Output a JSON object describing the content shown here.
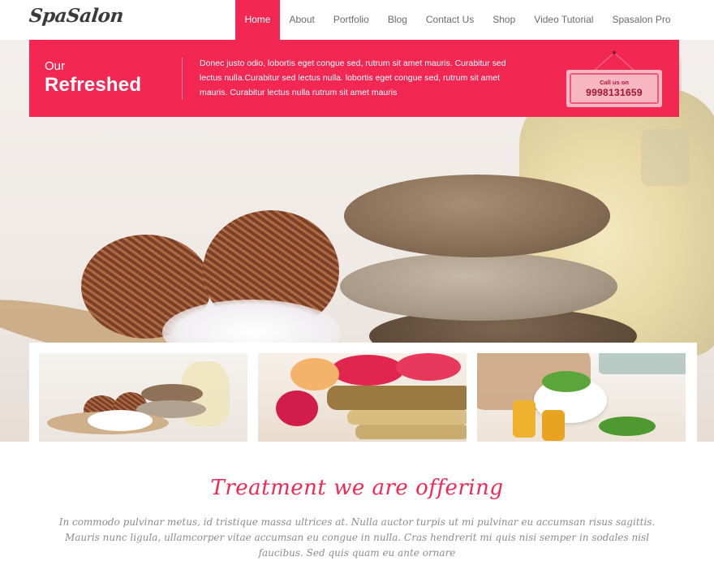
{
  "header": {
    "logo": "SpaSalon",
    "nav": [
      {
        "label": "Home",
        "active": true
      },
      {
        "label": "About"
      },
      {
        "label": "Portfolio"
      },
      {
        "label": "Blog"
      },
      {
        "label": "Contact Us"
      },
      {
        "label": "Shop"
      },
      {
        "label": "Video Tutorial"
      },
      {
        "label": "Spasalon Pro"
      }
    ]
  },
  "banner": {
    "small_title": "Our",
    "big_title": "Refreshed",
    "text": "Donec justo odio, lobortis eget congue sed, rutrum sit amet mauris. Curabitur sed lectus nulla.Curabitur sed lectus nulla. lobortis eget congue sed, rutrum sit amet mauris. Curabitur lectus nulla rutrum sit amet mauris",
    "call_label": "Call us on",
    "call_number": "9998131659"
  },
  "section": {
    "title": "Treatment we are offering",
    "text": "In commodo pulvinar metus, id tristique massa ultrices at. Nulla auctor turpis ut mi pulvinar eu accumsan risus sagittis. Mauris nunc ligula, ullamcorper vitae accumsan eu congue in nulla. Cras hendrerit mi quis nisi semper in sodales nisl faucibus. Sed quis quam eu ante ornare"
  },
  "colors": {
    "accent": "#f22853"
  }
}
